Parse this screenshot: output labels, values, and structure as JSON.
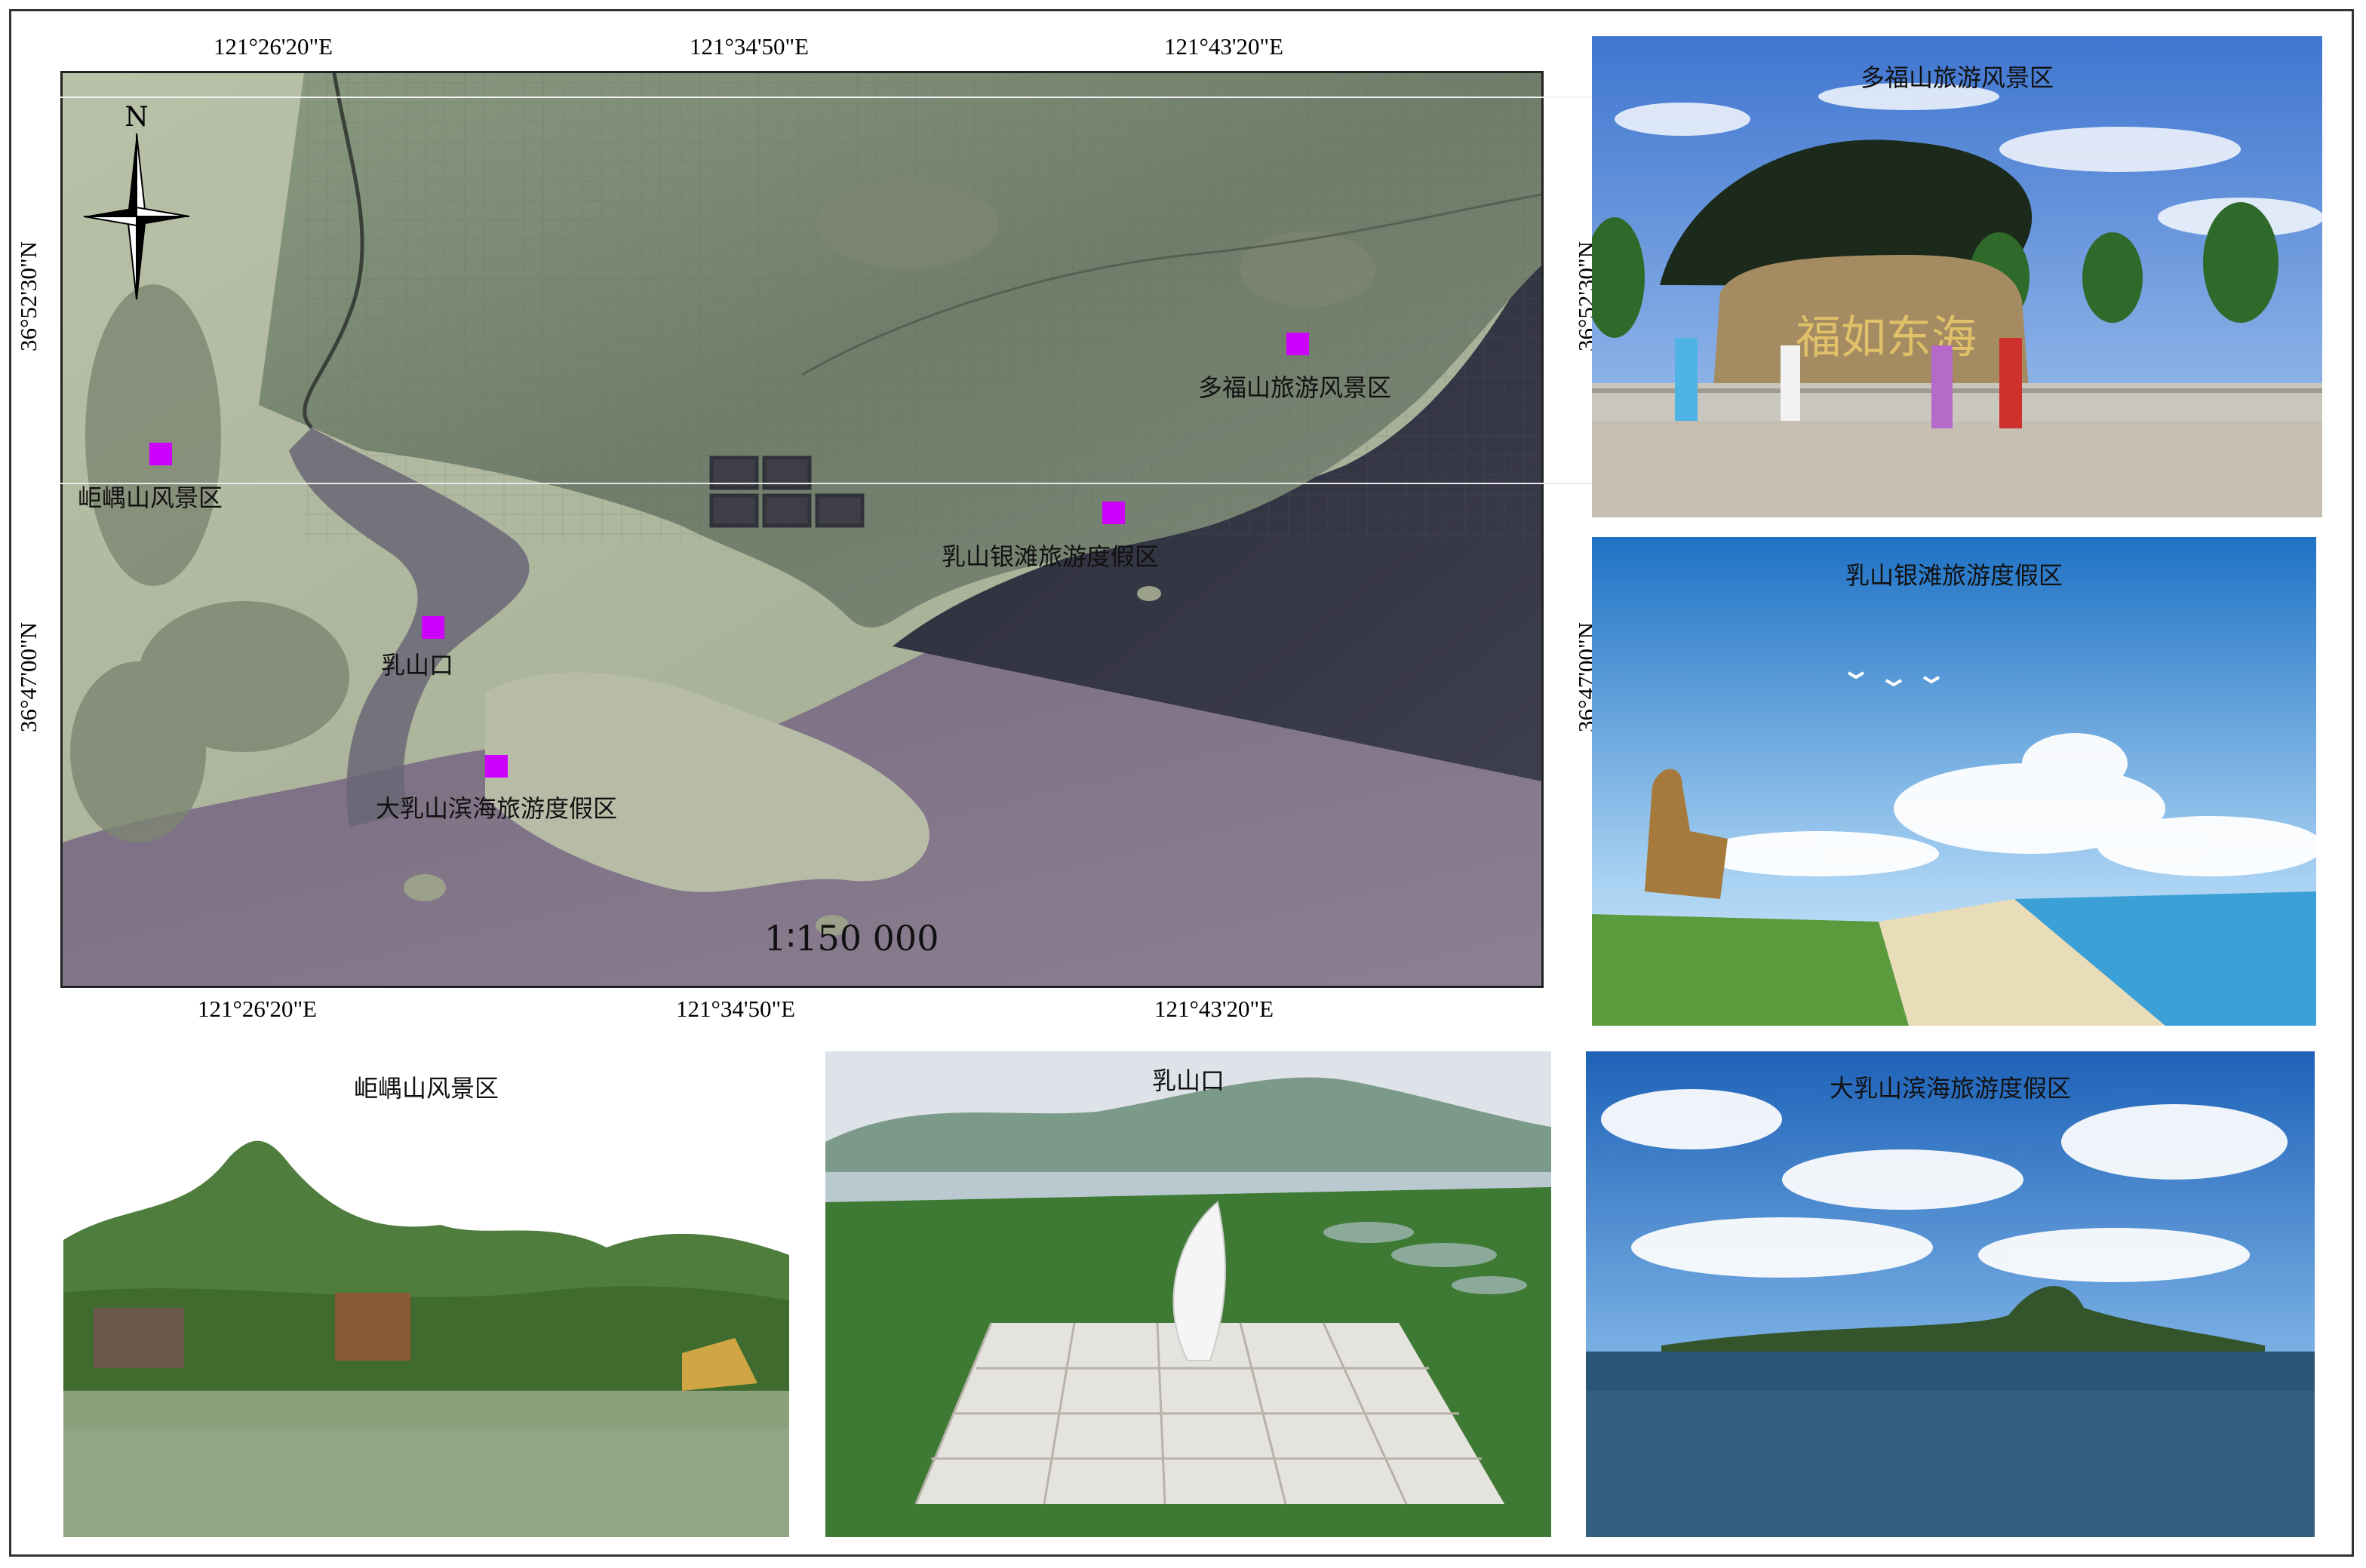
{
  "map": {
    "top_lon_labels": [
      "121°26'20\"E",
      "121°34'50\"E",
      "121°43'20\"E"
    ],
    "bottom_lon_labels": [
      "121°26'20\"E",
      "121°34'50\"E",
      "121°43'20\"E"
    ],
    "left_lat_labels": [
      "36°52'30\"N",
      "36°47'00\"N"
    ],
    "right_lat_labels": [
      "36°52'30\"N",
      "36°47'00\"N"
    ],
    "north_label": "N",
    "scale_text": "1∶150 000",
    "marker_color": "#cc00ff",
    "places": [
      {
        "name": "多福山旅游风景区"
      },
      {
        "name": "岠嵎山风景区"
      },
      {
        "name": "乳山银滩旅游度假区"
      },
      {
        "name": "乳山口"
      },
      {
        "name": "大乳山滨海旅游度假区"
      }
    ]
  },
  "photos": {
    "duofu": {
      "title": "多福山旅游风景区",
      "inscription": "福如东海"
    },
    "yintan": {
      "title": "乳山银滩旅游度假区"
    },
    "juyu": {
      "title": "岠嵎山风景区"
    },
    "rushankou": {
      "title": "乳山口"
    },
    "darushan": {
      "title": "大乳山滨海旅游度假区"
    }
  }
}
